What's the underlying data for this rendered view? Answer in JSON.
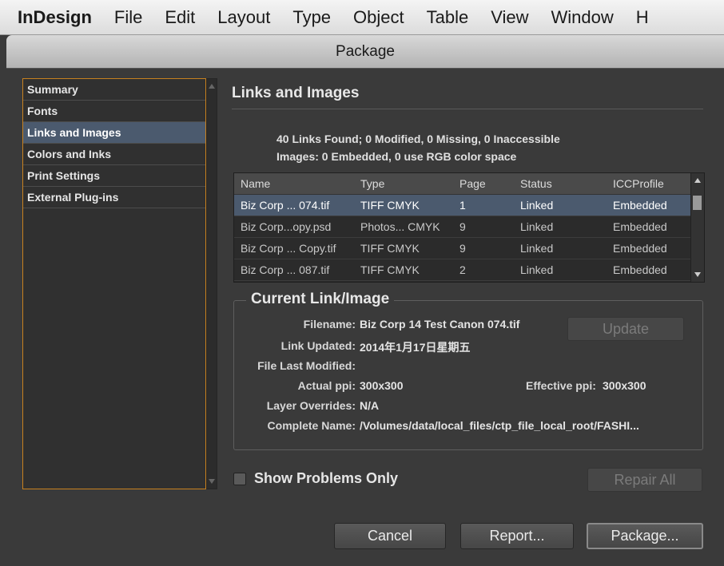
{
  "menubar": {
    "app_name": "InDesign",
    "items": [
      "File",
      "Edit",
      "Layout",
      "Type",
      "Object",
      "Table",
      "View",
      "Window",
      "H"
    ]
  },
  "dialog": {
    "title": "Package"
  },
  "sidebar": {
    "items": [
      {
        "label": "Summary"
      },
      {
        "label": "Fonts"
      },
      {
        "label": "Links and Images"
      },
      {
        "label": "Colors and Inks"
      },
      {
        "label": "Print Settings"
      },
      {
        "label": "External Plug-ins"
      }
    ],
    "selected_index": 2
  },
  "section": {
    "title": "Links and Images",
    "summary_line1": "40 Links Found; 0 Modified, 0 Missing, 0 Inaccessible",
    "summary_line2": "Images: 0 Embedded, 0 use RGB color space"
  },
  "table": {
    "columns": [
      "Name",
      "Type",
      "Page",
      "Status",
      "ICCProfile"
    ],
    "rows": [
      {
        "name": "Biz Corp ... 074.tif",
        "type": "TIFF CMYK",
        "page": "1",
        "status": "Linked",
        "icc": "Embedded"
      },
      {
        "name": "Biz Corp...opy.psd",
        "type": "Photos... CMYK",
        "page": "9",
        "status": "Linked",
        "icc": "Embedded"
      },
      {
        "name": "Biz Corp ... Copy.tif",
        "type": "TIFF CMYK",
        "page": "9",
        "status": "Linked",
        "icc": "Embedded"
      },
      {
        "name": "Biz Corp ... 087.tif",
        "type": "TIFF CMYK",
        "page": "2",
        "status": "Linked",
        "icc": "Embedded"
      }
    ],
    "selected_index": 0
  },
  "current": {
    "title": "Current Link/Image",
    "filename_label": "Filename:",
    "filename": "Biz Corp 14 Test Canon 074.tif",
    "link_updated_label": "Link Updated:",
    "link_updated": "2014年1月17日星期五",
    "file_last_modified_label": "File Last Modified:",
    "file_last_modified": "",
    "actual_ppi_label": "Actual ppi:",
    "actual_ppi": "300x300",
    "effective_ppi_label": "Effective ppi:",
    "effective_ppi": "300x300",
    "layer_overrides_label": "Layer Overrides:",
    "layer_overrides": "N/A",
    "complete_name_label": "Complete Name:",
    "complete_name": "/Volumes/data/local_files/ctp_file_local_root/FASHI...",
    "update_label": "Update"
  },
  "footer": {
    "show_problems_label": "Show Problems Only",
    "show_problems_checked": false,
    "repair_all_label": "Repair All",
    "cancel_label": "Cancel",
    "report_label": "Report...",
    "package_label": "Package..."
  },
  "colors": {
    "accent": "#c8811f",
    "selection": "#4b5a6e",
    "background": "#3a3a3a"
  }
}
